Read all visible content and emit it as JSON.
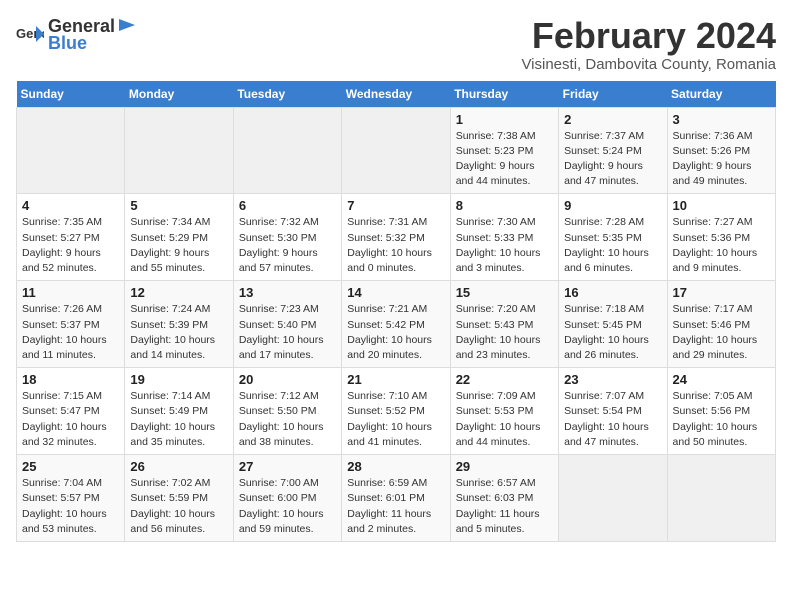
{
  "header": {
    "logo_general": "General",
    "logo_blue": "Blue",
    "month_title": "February 2024",
    "location": "Visinesti, Dambovita County, Romania"
  },
  "calendar": {
    "days_of_week": [
      "Sunday",
      "Monday",
      "Tuesday",
      "Wednesday",
      "Thursday",
      "Friday",
      "Saturday"
    ],
    "weeks": [
      [
        {
          "day": "",
          "info": ""
        },
        {
          "day": "",
          "info": ""
        },
        {
          "day": "",
          "info": ""
        },
        {
          "day": "",
          "info": ""
        },
        {
          "day": "1",
          "info": "Sunrise: 7:38 AM\nSunset: 5:23 PM\nDaylight: 9 hours\nand 44 minutes."
        },
        {
          "day": "2",
          "info": "Sunrise: 7:37 AM\nSunset: 5:24 PM\nDaylight: 9 hours\nand 47 minutes."
        },
        {
          "day": "3",
          "info": "Sunrise: 7:36 AM\nSunset: 5:26 PM\nDaylight: 9 hours\nand 49 minutes."
        }
      ],
      [
        {
          "day": "4",
          "info": "Sunrise: 7:35 AM\nSunset: 5:27 PM\nDaylight: 9 hours\nand 52 minutes."
        },
        {
          "day": "5",
          "info": "Sunrise: 7:34 AM\nSunset: 5:29 PM\nDaylight: 9 hours\nand 55 minutes."
        },
        {
          "day": "6",
          "info": "Sunrise: 7:32 AM\nSunset: 5:30 PM\nDaylight: 9 hours\nand 57 minutes."
        },
        {
          "day": "7",
          "info": "Sunrise: 7:31 AM\nSunset: 5:32 PM\nDaylight: 10 hours\nand 0 minutes."
        },
        {
          "day": "8",
          "info": "Sunrise: 7:30 AM\nSunset: 5:33 PM\nDaylight: 10 hours\nand 3 minutes."
        },
        {
          "day": "9",
          "info": "Sunrise: 7:28 AM\nSunset: 5:35 PM\nDaylight: 10 hours\nand 6 minutes."
        },
        {
          "day": "10",
          "info": "Sunrise: 7:27 AM\nSunset: 5:36 PM\nDaylight: 10 hours\nand 9 minutes."
        }
      ],
      [
        {
          "day": "11",
          "info": "Sunrise: 7:26 AM\nSunset: 5:37 PM\nDaylight: 10 hours\nand 11 minutes."
        },
        {
          "day": "12",
          "info": "Sunrise: 7:24 AM\nSunset: 5:39 PM\nDaylight: 10 hours\nand 14 minutes."
        },
        {
          "day": "13",
          "info": "Sunrise: 7:23 AM\nSunset: 5:40 PM\nDaylight: 10 hours\nand 17 minutes."
        },
        {
          "day": "14",
          "info": "Sunrise: 7:21 AM\nSunset: 5:42 PM\nDaylight: 10 hours\nand 20 minutes."
        },
        {
          "day": "15",
          "info": "Sunrise: 7:20 AM\nSunset: 5:43 PM\nDaylight: 10 hours\nand 23 minutes."
        },
        {
          "day": "16",
          "info": "Sunrise: 7:18 AM\nSunset: 5:45 PM\nDaylight: 10 hours\nand 26 minutes."
        },
        {
          "day": "17",
          "info": "Sunrise: 7:17 AM\nSunset: 5:46 PM\nDaylight: 10 hours\nand 29 minutes."
        }
      ],
      [
        {
          "day": "18",
          "info": "Sunrise: 7:15 AM\nSunset: 5:47 PM\nDaylight: 10 hours\nand 32 minutes."
        },
        {
          "day": "19",
          "info": "Sunrise: 7:14 AM\nSunset: 5:49 PM\nDaylight: 10 hours\nand 35 minutes."
        },
        {
          "day": "20",
          "info": "Sunrise: 7:12 AM\nSunset: 5:50 PM\nDaylight: 10 hours\nand 38 minutes."
        },
        {
          "day": "21",
          "info": "Sunrise: 7:10 AM\nSunset: 5:52 PM\nDaylight: 10 hours\nand 41 minutes."
        },
        {
          "day": "22",
          "info": "Sunrise: 7:09 AM\nSunset: 5:53 PM\nDaylight: 10 hours\nand 44 minutes."
        },
        {
          "day": "23",
          "info": "Sunrise: 7:07 AM\nSunset: 5:54 PM\nDaylight: 10 hours\nand 47 minutes."
        },
        {
          "day": "24",
          "info": "Sunrise: 7:05 AM\nSunset: 5:56 PM\nDaylight: 10 hours\nand 50 minutes."
        }
      ],
      [
        {
          "day": "25",
          "info": "Sunrise: 7:04 AM\nSunset: 5:57 PM\nDaylight: 10 hours\nand 53 minutes."
        },
        {
          "day": "26",
          "info": "Sunrise: 7:02 AM\nSunset: 5:59 PM\nDaylight: 10 hours\nand 56 minutes."
        },
        {
          "day": "27",
          "info": "Sunrise: 7:00 AM\nSunset: 6:00 PM\nDaylight: 10 hours\nand 59 minutes."
        },
        {
          "day": "28",
          "info": "Sunrise: 6:59 AM\nSunset: 6:01 PM\nDaylight: 11 hours\nand 2 minutes."
        },
        {
          "day": "29",
          "info": "Sunrise: 6:57 AM\nSunset: 6:03 PM\nDaylight: 11 hours\nand 5 minutes."
        },
        {
          "day": "",
          "info": ""
        },
        {
          "day": "",
          "info": ""
        }
      ]
    ]
  }
}
